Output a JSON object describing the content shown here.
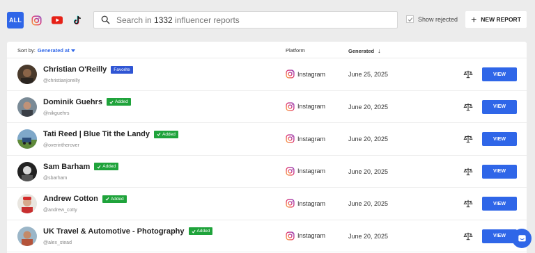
{
  "platform_filters": {
    "all_label": "ALL",
    "instagram_icon": "instagram-icon",
    "youtube_icon": "youtube-icon",
    "tiktok_icon": "tiktok-icon"
  },
  "search": {
    "prefix": "Search in ",
    "count": "1332",
    "suffix": " influencer reports"
  },
  "show_rejected": {
    "label": "Show rejected",
    "checked": true
  },
  "new_report": {
    "label": "NEW REPORT"
  },
  "table": {
    "sort_label": "Sort by:",
    "sort_value": "Generated at",
    "col_platform": "Platform",
    "col_generated": "Generated",
    "view_label": "VIEW"
  },
  "rows": [
    {
      "name": "Christian O'Reilly",
      "badge": "Favorite",
      "badge_type": "favorite",
      "handle": "@christianjoreilly",
      "platform": "Instagram",
      "date": "June 25, 2025"
    },
    {
      "name": "Dominik Guehrs",
      "badge": "Added",
      "badge_type": "added",
      "handle": "@nikguehrs",
      "platform": "Instagram",
      "date": "June 20, 2025"
    },
    {
      "name": "Tati Reed | Blue Tit the Landy",
      "badge": "Added",
      "badge_type": "added",
      "handle": "@overintherover",
      "platform": "Instagram",
      "date": "June 20, 2025"
    },
    {
      "name": "Sam Barham",
      "badge": "Added",
      "badge_type": "added",
      "handle": "@sbarham",
      "platform": "Instagram",
      "date": "June 20, 2025"
    },
    {
      "name": "Andrew Cotton",
      "badge": "Added",
      "badge_type": "added",
      "handle": "@andrew_cotty",
      "platform": "Instagram",
      "date": "June 20, 2025"
    },
    {
      "name": "UK Travel & Automotive - Photography",
      "badge": "Added",
      "badge_type": "added",
      "handle": "@alex_stead",
      "platform": "Instagram",
      "date": "June 20, 2025"
    }
  ],
  "colors": {
    "accent": "#2f66e8",
    "favorite_badge": "#2f55d4",
    "added_badge": "#1fa33b",
    "background": "#ececec"
  }
}
